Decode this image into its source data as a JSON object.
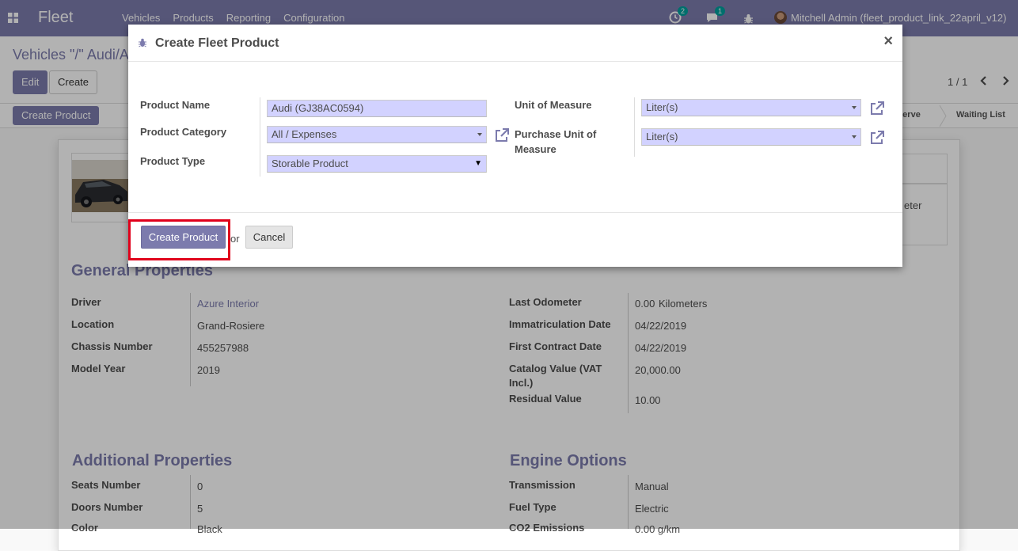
{
  "navbar": {
    "brand": "Fleet",
    "menu": [
      "Vehicles",
      "Products",
      "Reporting",
      "Configuration"
    ],
    "activity_count": "2",
    "messages_count": "1",
    "user": "Mitchell Admin (fleet_product_link_22april_v12)"
  },
  "control_panel": {
    "breadcrumb": "Vehicles \"/\" Audi/A",
    "edit_label": "Edit",
    "create_label": "Create",
    "pager": "1 / 1"
  },
  "statusbar": {
    "create_product_label": "Create Product",
    "stage_reserve": "Reserve",
    "stage_waiting": "Waiting List"
  },
  "form": {
    "smart_button_partial": "eter",
    "general_title": "General Properties",
    "general_left": [
      {
        "label": "Driver",
        "value": "Azure Interior"
      },
      {
        "label": "Location",
        "value": "Grand-Rosiere"
      },
      {
        "label": "Chassis Number",
        "value": "455257988"
      },
      {
        "label": "Model Year",
        "value": "2019"
      }
    ],
    "general_right": [
      {
        "label": "Last Odometer",
        "value": "0.00",
        "unit": "Kilometers"
      },
      {
        "label": "Immatriculation Date",
        "value": "04/22/2019"
      },
      {
        "label": "First Contract Date",
        "value": "04/22/2019"
      },
      {
        "label": "Catalog Value (VAT Incl.)",
        "value": "20,000.00"
      },
      {
        "label": "Residual Value",
        "value": "10.00"
      }
    ],
    "additional_title": "Additional Properties",
    "additional": [
      {
        "label": "Seats Number",
        "value": "0"
      },
      {
        "label": "Doors Number",
        "value": "5"
      },
      {
        "label": "Color",
        "value": "Black"
      }
    ],
    "engine_title": "Engine Options",
    "engine": [
      {
        "label": "Transmission",
        "value": "Manual"
      },
      {
        "label": "Fuel Type",
        "value": "Electric"
      },
      {
        "label": "CO2 Emissions",
        "value": "0.00 g/km"
      }
    ]
  },
  "modal": {
    "title": "Create Fleet Product",
    "close": "×",
    "fields_left": [
      {
        "label": "Product Name",
        "value": "Audi (GJ38AC0594)"
      },
      {
        "label": "Product Category",
        "value": "All / Expenses"
      },
      {
        "label": "Product Type",
        "value": "Storable Product"
      }
    ],
    "fields_right": [
      {
        "label": "Unit of Measure",
        "value": "Liter(s)"
      },
      {
        "label": "Purchase Unit of Measure",
        "value": "Liter(s)"
      }
    ],
    "create_button": "Create Product",
    "or": "or",
    "cancel_button": "Cancel"
  },
  "colors": {
    "brand": "#7c7bad",
    "required_field": "#d2d2ff",
    "highlight": "#e0001b"
  }
}
